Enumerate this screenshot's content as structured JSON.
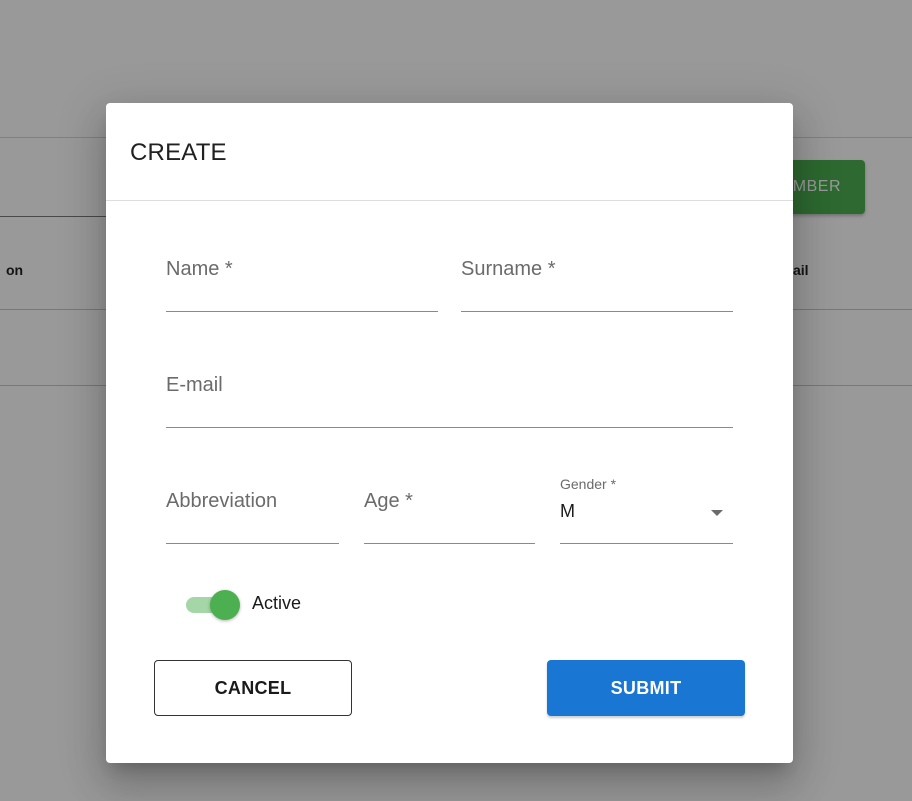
{
  "background": {
    "add_button_label": "MBER",
    "column_left_label": "on",
    "column_right_label": "ail"
  },
  "dialog": {
    "title": "CREATE",
    "fields": {
      "name": {
        "label": "Name *",
        "value": ""
      },
      "surname": {
        "label": "Surname *",
        "value": ""
      },
      "email": {
        "label": "E-mail",
        "value": ""
      },
      "abbreviation": {
        "label": "Abbreviation",
        "value": ""
      },
      "age": {
        "label": "Age *",
        "value": ""
      },
      "gender": {
        "label": "Gender *",
        "value": "M"
      }
    },
    "active_toggle": {
      "label": "Active",
      "checked": true
    },
    "cancel_label": "CANCEL",
    "submit_label": "SUBMIT"
  },
  "colors": {
    "accent_green": "#4caf50",
    "submit_blue": "#1976d2",
    "overlay": "rgba(0,0,0,0.4)"
  },
  "icons": {
    "gender_dropdown": "chevron-down-icon"
  }
}
